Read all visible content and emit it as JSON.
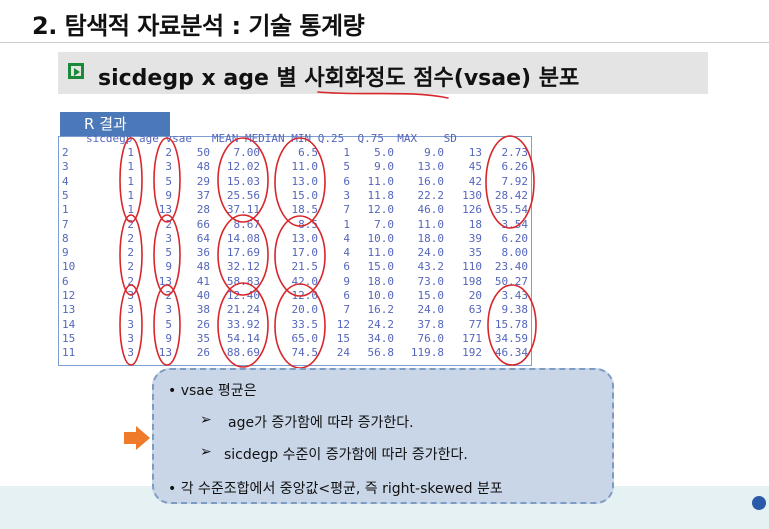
{
  "slide": {
    "title": "2. 탐색적 자료분석 : 기술 통계량",
    "subtitle": "sicdegp x age 별 사회화정도 점수(vsae) 분포",
    "result_tab": "R 결과"
  },
  "table": {
    "header": "sicdegp age vsae   MEAN MEDIAN MIN Q.25  Q.75  MAX    SD",
    "rows": [
      {
        "idx": "2",
        "sicdegp": "1",
        "age": "2",
        "vsae": "50",
        "mean": "7.00",
        "median": "6.5",
        "min": "1",
        "q25": "5.0",
        "q75": "9.0",
        "max": "13",
        "sd": "2.73"
      },
      {
        "idx": "3",
        "sicdegp": "1",
        "age": "3",
        "vsae": "48",
        "mean": "12.02",
        "median": "11.0",
        "min": "5",
        "q25": "9.0",
        "q75": "13.0",
        "max": "45",
        "sd": "6.26"
      },
      {
        "idx": "4",
        "sicdegp": "1",
        "age": "5",
        "vsae": "29",
        "mean": "15.03",
        "median": "13.0",
        "min": "6",
        "q25": "11.0",
        "q75": "16.0",
        "max": "42",
        "sd": "7.92"
      },
      {
        "idx": "5",
        "sicdegp": "1",
        "age": "9",
        "vsae": "37",
        "mean": "25.56",
        "median": "15.0",
        "min": "3",
        "q25": "11.8",
        "q75": "22.2",
        "max": "130",
        "sd": "28.42"
      },
      {
        "idx": "1",
        "sicdegp": "1",
        "age": "13",
        "vsae": "28",
        "mean": "37.11",
        "median": "18.5",
        "min": "7",
        "q25": "12.0",
        "q75": "46.0",
        "max": "126",
        "sd": "35.54"
      },
      {
        "idx": "7",
        "sicdegp": "2",
        "age": "2",
        "vsae": "66",
        "mean": "8.67",
        "median": "8.5",
        "min": "1",
        "q25": "7.0",
        "q75": "11.0",
        "max": "18",
        "sd": "3.54"
      },
      {
        "idx": "8",
        "sicdegp": "2",
        "age": "3",
        "vsae": "64",
        "mean": "14.08",
        "median": "13.0",
        "min": "4",
        "q25": "10.0",
        "q75": "18.0",
        "max": "39",
        "sd": "6.20"
      },
      {
        "idx": "9",
        "sicdegp": "2",
        "age": "5",
        "vsae": "36",
        "mean": "17.69",
        "median": "17.0",
        "min": "4",
        "q25": "11.0",
        "q75": "24.0",
        "max": "35",
        "sd": "8.00"
      },
      {
        "idx": "10",
        "sicdegp": "2",
        "age": "9",
        "vsae": "48",
        "mean": "32.12",
        "median": "21.5",
        "min": "6",
        "q25": "15.0",
        "q75": "43.2",
        "max": "110",
        "sd": "23.40"
      },
      {
        "idx": "6",
        "sicdegp": "2",
        "age": "13",
        "vsae": "41",
        "mean": "58.83",
        "median": "42.0",
        "min": "9",
        "q25": "18.0",
        "q75": "73.0",
        "max": "198",
        "sd": "50.27"
      },
      {
        "idx": "12",
        "sicdegp": "3",
        "age": "2",
        "vsae": "40",
        "mean": "12.40",
        "median": "12.0",
        "min": "6",
        "q25": "10.0",
        "q75": "15.0",
        "max": "20",
        "sd": "3.43"
      },
      {
        "idx": "13",
        "sicdegp": "3",
        "age": "3",
        "vsae": "38",
        "mean": "21.24",
        "median": "20.0",
        "min": "7",
        "q25": "16.2",
        "q75": "24.0",
        "max": "63",
        "sd": "9.38"
      },
      {
        "idx": "14",
        "sicdegp": "3",
        "age": "5",
        "vsae": "26",
        "mean": "33.92",
        "median": "33.5",
        "min": "12",
        "q25": "24.2",
        "q75": "37.8",
        "max": "77",
        "sd": "15.78"
      },
      {
        "idx": "15",
        "sicdegp": "3",
        "age": "9",
        "vsae": "35",
        "mean": "54.14",
        "median": "65.0",
        "min": "15",
        "q25": "34.0",
        "q75": "76.0",
        "max": "171",
        "sd": "34.59"
      },
      {
        "idx": "11",
        "sicdegp": "3",
        "age": "13",
        "vsae": "26",
        "mean": "88.69",
        "median": "74.5",
        "min": "24",
        "q25": "56.8",
        "q75": "119.8",
        "max": "192",
        "sd": "46.34"
      }
    ]
  },
  "notes": {
    "line1": "• vsae 평균은",
    "line2": "age가 증가함에 따라 증가한다.",
    "line3": "sicdegp 수준이  증가함에 따라 증가한다.",
    "line4": "• 각 수준조합에서 중앙값<평균, 즉 right-skewed 분포",
    "bullet_arrow": "➢"
  },
  "colors": {
    "table_text": "#5566bb",
    "tab_blue": "#4a78b8",
    "annotation_red": "#d8262b",
    "note_bg": "#c9d6e8",
    "arrow_orange": "#ee7a2a"
  }
}
